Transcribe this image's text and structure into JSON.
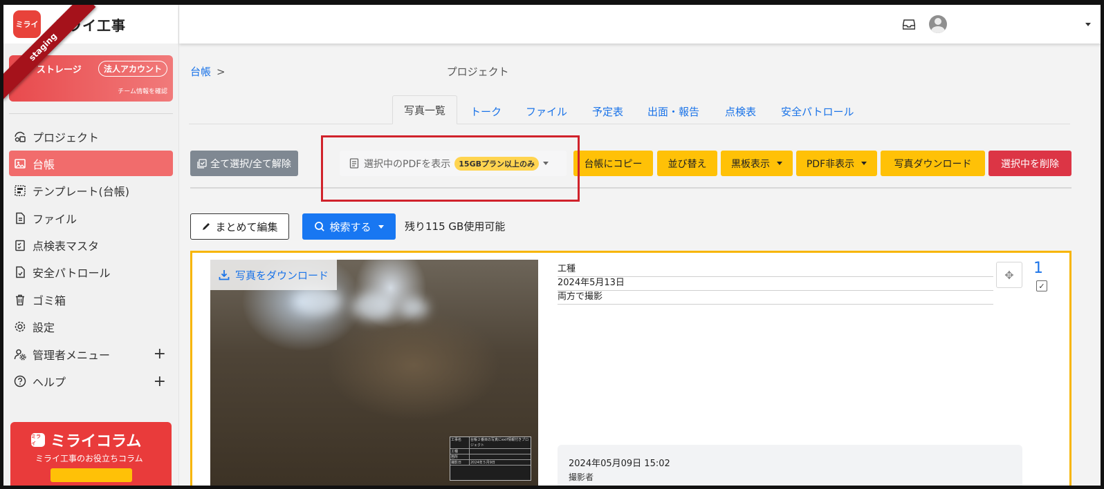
{
  "app": {
    "brand_name": "ミライ工事",
    "brand_logo_text": "ミライ",
    "env_ribbon": "staging"
  },
  "sidebar": {
    "storage_title": "ストレージ",
    "corp_badge": "法人アカウント",
    "team_link": "チーム情報を確認",
    "items": [
      {
        "label": "プロジェクト",
        "icon": "project-icon"
      },
      {
        "label": "台帳",
        "icon": "ledger-icon",
        "active": true
      },
      {
        "label": "テンプレート(台帳)",
        "icon": "template-icon"
      },
      {
        "label": "ファイル",
        "icon": "file-icon"
      },
      {
        "label": "点検表マスタ",
        "icon": "checklist-icon"
      },
      {
        "label": "安全パトロール",
        "icon": "patrol-icon"
      },
      {
        "label": "ゴミ箱",
        "icon": "trash-icon"
      },
      {
        "label": "設定",
        "icon": "gear-icon"
      },
      {
        "label": "管理者メニュー",
        "icon": "admin-icon",
        "expandable": true
      },
      {
        "label": "ヘルプ",
        "icon": "help-icon",
        "expandable": true
      }
    ],
    "expand_symbol": "+",
    "column_banner": {
      "title": "ミライコラム",
      "logo_text": "ミライ",
      "subtitle": "ミライ工事のお役立ちコラム"
    }
  },
  "header": {
    "inbox_icon": "inbox-icon",
    "avatar_icon": "user-avatar-icon"
  },
  "breadcrumb": {
    "root": "台帳",
    "separator": ">",
    "project": "プロジェクト"
  },
  "tabs": [
    {
      "label": "写真一覧",
      "active": true
    },
    {
      "label": "トーク"
    },
    {
      "label": "ファイル"
    },
    {
      "label": "予定表"
    },
    {
      "label": "出面・報告"
    },
    {
      "label": "点検表"
    },
    {
      "label": "安全パトロール"
    }
  ],
  "toolbar": {
    "select_all": "全て選択/全て解除",
    "show_pdf": "選択中のPDFを表示",
    "pdf_badge": "15GBプラン以上のみ",
    "copy_to_ledger": "台帳にコピー",
    "sort": "並び替え",
    "blackboard_display": "黒板表示",
    "pdf_hide": "PDF非表示",
    "photo_download": "写真ダウンロード",
    "delete_selected": "選択中を削除"
  },
  "row2": {
    "bulk_edit": "まとめて編集",
    "search": "検索する",
    "remaining": "残り115 GB使用可能"
  },
  "photo_card": {
    "download_label": "写真をダウンロード",
    "fields": [
      "工種",
      "2024年5月13日",
      "両方で撮影"
    ],
    "number": "1",
    "checked": true,
    "check_symbol": "✓",
    "move_symbol": "✥",
    "meta_date": "2024年05月09日 15:02",
    "meta_sub": "撮影者",
    "blackboard": {
      "rows": [
        {
          "k": "工事名",
          "v": "台帳２番目の写真にexif情報付きプロジェクト"
        },
        {
          "k": "工種",
          "v": ""
        },
        {
          "k": "箇所",
          "v": ""
        },
        {
          "k": "撮影日",
          "v": "2024年５月9日"
        }
      ]
    }
  },
  "colors": {
    "accent_red": "#f16c6c",
    "brand_red": "#e8423a",
    "link_blue": "#1a73e8",
    "warning_yellow": "#ffc107",
    "danger_red": "#dc3545",
    "highlight_box": "#d0222b",
    "card_border": "#f7b500"
  }
}
